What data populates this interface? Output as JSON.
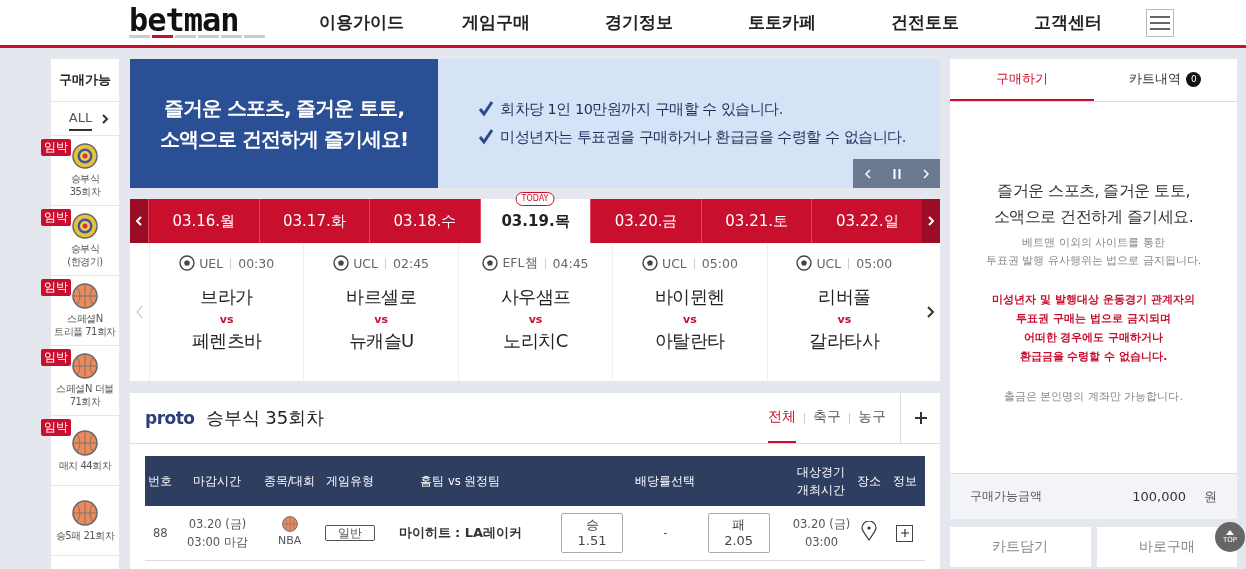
{
  "header": {
    "logo": "betman",
    "nav": [
      "이용가이드",
      "게임구매",
      "경기정보",
      "토토카페",
      "건전토토",
      "고객센터"
    ]
  },
  "sidebar": {
    "title": "구매가능",
    "filter": {
      "label": "ALL",
      "selected": true
    },
    "items": [
      {
        "kind": "target",
        "urgent": true,
        "badge": "임박",
        "lines": [
          "승부식",
          "35회차"
        ]
      },
      {
        "kind": "target",
        "urgent": true,
        "badge": "임박",
        "lines": [
          "승부식",
          "(한경기)"
        ]
      },
      {
        "kind": "basketball",
        "urgent": true,
        "badge": "임박",
        "lines": [
          "스페셜N",
          "트리플 71회차"
        ]
      },
      {
        "kind": "basketball",
        "urgent": true,
        "badge": "임박",
        "lines": [
          "스페셜N 더블",
          "71회차"
        ]
      },
      {
        "kind": "basketball",
        "urgent": true,
        "badge": "임박",
        "lines": [
          "매치 44회차"
        ]
      },
      {
        "kind": "basketball",
        "urgent": false,
        "lines": [
          "승5패 21회차"
        ]
      }
    ]
  },
  "banner": {
    "headline": [
      "즐거운 스포츠, 즐거운 토토,",
      "소액으로 건전하게 즐기세요!"
    ],
    "notices": [
      "회차당 1인 10만원까지 구매할 수 있습니다.",
      "미성년자는 투표권을 구매하거나 환급금을 수령할 수 없습니다."
    ]
  },
  "dates": {
    "today_badge": "TODAY",
    "tabs": [
      {
        "label": "03.16.월",
        "selected": false
      },
      {
        "label": "03.17.화",
        "selected": false
      },
      {
        "label": "03.18.수",
        "selected": false
      },
      {
        "label": "03.19.목",
        "selected": true
      },
      {
        "label": "03.20.금",
        "selected": false
      },
      {
        "label": "03.21.토",
        "selected": false
      },
      {
        "label": "03.22.일",
        "selected": false
      }
    ]
  },
  "matches": [
    {
      "league": "UEL",
      "time": "00:30",
      "home": "브라가",
      "vs": "vs",
      "away": "페렌츠바"
    },
    {
      "league": "UCL",
      "time": "02:45",
      "home": "바르셀로",
      "vs": "vs",
      "away": "뉴캐슬U"
    },
    {
      "league": "EFL챔",
      "time": "04:45",
      "home": "사우샘프",
      "vs": "vs",
      "away": "노리치C"
    },
    {
      "league": "UCL",
      "time": "05:00",
      "home": "바이뮌헨",
      "vs": "vs",
      "away": "아탈란타"
    },
    {
      "league": "UCL",
      "time": "05:00",
      "home": "리버풀",
      "vs": "vs",
      "away": "갈라타사"
    }
  ],
  "game": {
    "brand": "proto",
    "title": "승부식 35회차",
    "filters": [
      {
        "label": "전체",
        "selected": true
      },
      {
        "label": "축구",
        "selected": false
      },
      {
        "label": "농구",
        "selected": false
      }
    ],
    "columns": [
      "번호",
      "마감시간",
      "종목/대회",
      "게임유형",
      "홈팀 vs 원정팀",
      "배당률선택",
      [
        "대상경기",
        "개최시간"
      ],
      "장소",
      "정보"
    ],
    "rows": [
      {
        "no": "88",
        "deadline": [
          "03.20 (금)",
          "03:00 마감"
        ],
        "kind": "basketball",
        "league": "NBA",
        "type": "일반",
        "teams": "마이히트 : LA레이커",
        "win": {
          "label": "승",
          "odds": "1.51"
        },
        "draw": "-",
        "lose": {
          "label": "패",
          "odds": "2.05"
        },
        "start": [
          "03.20 (금)",
          "03:00"
        ]
      }
    ]
  },
  "cart": {
    "tabs": [
      {
        "label": "구매하기",
        "selected": true
      },
      {
        "label": "카트내역",
        "count": "0",
        "selected": false
      }
    ],
    "headline": [
      "즐거운 스포츠, 즐거운 토토,",
      "소액으로 건전하게 즐기세요."
    ],
    "notice": [
      "베트맨 이외의 사이트를 통한",
      "투표권 발행 유사행위는 법으로 금지됩니다."
    ],
    "warning": [
      "미성년자 및 발행대상 운동경기 관계자의",
      "투표권 구매는 법으로 금지되며",
      "어떠한 경우에도 구매하거나",
      "환급금을 수령할 수 없습니다."
    ],
    "account_note": "출금은 본인명의 계좌만 가능합니다.",
    "balance": {
      "label": "구매가능금액",
      "amount": "100,000",
      "unit": "원"
    },
    "buttons": [
      "카트담기",
      "바로구매"
    ]
  },
  "top_button": "TOP"
}
